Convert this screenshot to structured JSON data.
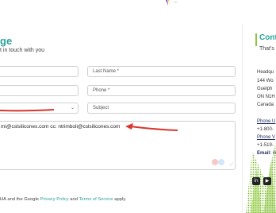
{
  "header": {
    "close_glyph": "–"
  },
  "form": {
    "title": "ge",
    "subtitle": "t in touch with you",
    "fields": {
      "first_name": "",
      "last_name": "Last Name *",
      "email": "",
      "phone": "Phone *",
      "department": "",
      "subject": "Subject"
    },
    "message": "mi@cslsilicones.com cc: ntrimboli@cslsilicones.com",
    "recaptcha_notice": {
      "prefix": "HA and the Google ",
      "privacy": "Privacy Policy",
      "and": " and ",
      "terms": "Terms of Service",
      "suffix": " apply."
    }
  },
  "contact": {
    "title": "Cont",
    "subtitle": "That's",
    "address": [
      "Headqu",
      "144 Wo",
      "Guelph",
      "ON N1H",
      "Canada"
    ],
    "phone_label": "Phone U",
    "phone_value": "+1-800-",
    "phone2_label": "Phone V",
    "phone2_value": "+1-519-",
    "email_label": "Email:",
    "email_value": "in"
  },
  "social": {
    "linkedin": "in",
    "youtube": "▶"
  },
  "colors": {
    "accent": "#2aa39a",
    "green": "#8dc63f",
    "arrow": "#d9362b"
  }
}
